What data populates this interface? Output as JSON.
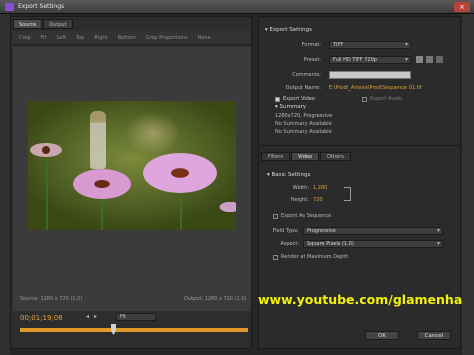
{
  "window": {
    "title": "Export Settings",
    "close_glyph": "×"
  },
  "left": {
    "tabs": [
      "Source",
      "Output"
    ],
    "toolbar_items": [
      "Crop",
      "Fit",
      "Left",
      "Top",
      "Right",
      "Bottom",
      "Crop Proportions",
      "None"
    ],
    "source_info": "Source: 1280 x 720 (1.0)",
    "output_info": "Output: 1280 x 720 (1.0)",
    "timecode": "00;01;19;08",
    "fit_label": "Fit",
    "progress": 0.41
  },
  "right": {
    "export_settings_label": "Export Settings",
    "format_label": "Format:",
    "format_value": "TIFF",
    "preset_label": "Preset:",
    "preset_value": "Full HD TIFF 720p",
    "comments_label": "Comments:",
    "comments_value": "",
    "output_name_label": "Output Name:",
    "output_name_value": "E:\\Prod\\_Arteira\\Prod\\Sequence 01.tif",
    "export_video_label": "Export Video",
    "export_audio_label": "Export Audio",
    "summary_label": "Summary",
    "summary_lines": [
      "1280x720, Progressive",
      "No Summary Available",
      "No Summary Available"
    ],
    "tabs": [
      "Filters",
      "Video",
      "Others"
    ],
    "basic_settings_label": "Basic Settings",
    "width_label": "Width:",
    "width_value": "1,280",
    "height_label": "Height:",
    "height_value": "720",
    "export_sequence_label": "Export As Sequence",
    "field_type_label": "Field Type:",
    "field_type_value": "Progressive",
    "aspect_label": "Aspect:",
    "aspect_value": "Square Pixels (1.0)",
    "render_max_label": "Render at Maximum Depth",
    "ok_label": "OK",
    "cancel_label": "Cancel"
  },
  "overlay": {
    "watermark": "www.youtube.com/glamenha"
  },
  "icons": [
    "app-icon",
    "close-icon",
    "save-preset-icon",
    "import-preset-icon",
    "delete-preset-icon",
    "chain-link-icon",
    "play-icon"
  ],
  "colors": {
    "timecode": "#e0a23c",
    "link": "#d9a43a",
    "watermark": "#f2f20a",
    "progress": "#e19a2a"
  }
}
